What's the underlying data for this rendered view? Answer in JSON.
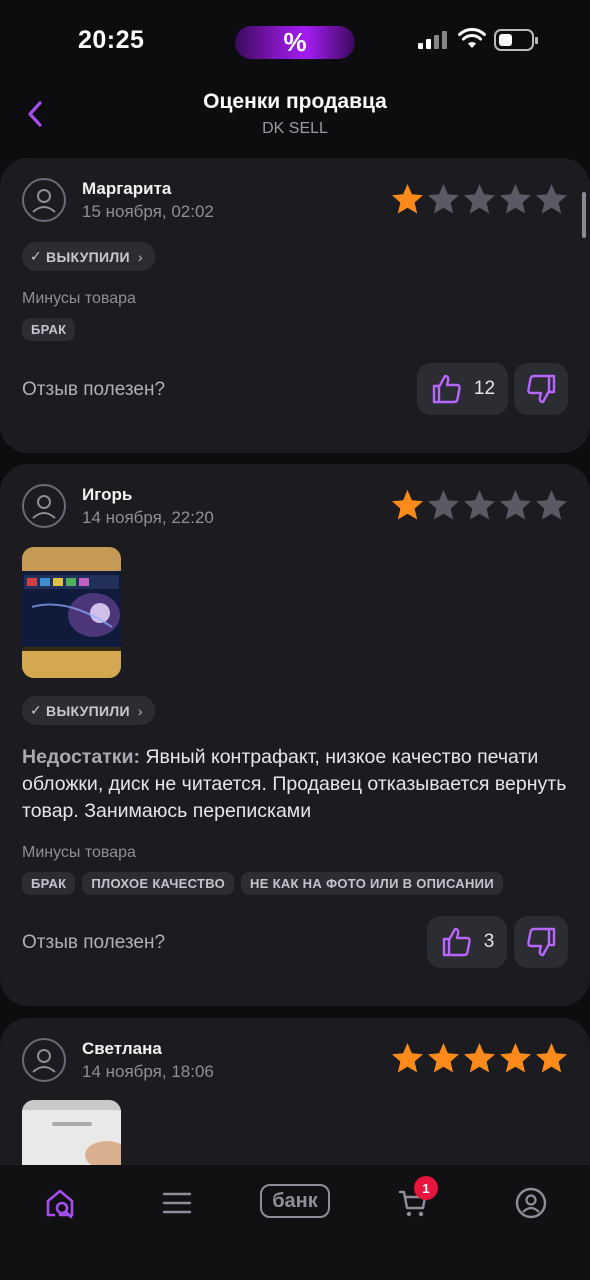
{
  "status_bar": {
    "time": "20:25",
    "promo_symbol": "%"
  },
  "header": {
    "title": "Оценки продавца",
    "subtitle": "DK SELL"
  },
  "reviews": [
    {
      "author": "Маргарита",
      "date": "15 ноября, 02:02",
      "rating": 1,
      "purchased_label": "ВЫКУПИЛИ",
      "cons_label": "Минусы товара",
      "tags": [
        "БРАК"
      ],
      "helpful_label": "Отзыв полезен?",
      "likes": "12"
    },
    {
      "author": "Игорь",
      "date": "14 ноября, 22:20",
      "rating": 1,
      "purchased_label": "ВЫКУПИЛИ",
      "text_prefix": "Недостатки:",
      "text": "Явный контрафакт, низкое качество печати обложки, диск не читается. Продавец отказывается вернуть товар. Занимаюсь переписками",
      "cons_label": "Минусы товара",
      "tags": [
        "БРАК",
        "ПЛОХОЕ КАЧЕСТВО",
        "НЕ КАК НА ФОТО ИЛИ В ОПИСАНИИ"
      ],
      "helpful_label": "Отзыв полезен?",
      "likes": "3"
    },
    {
      "author": "Светлана",
      "date": "14 ноября, 18:06",
      "rating": 5
    }
  ],
  "tabbar": {
    "bank_label": "банк",
    "cart_badge": "1"
  },
  "colors": {
    "accent": "#a64df0",
    "star_filled": "#ff8a1c",
    "star_empty": "#5a5a64",
    "badge": "#e5153b"
  }
}
